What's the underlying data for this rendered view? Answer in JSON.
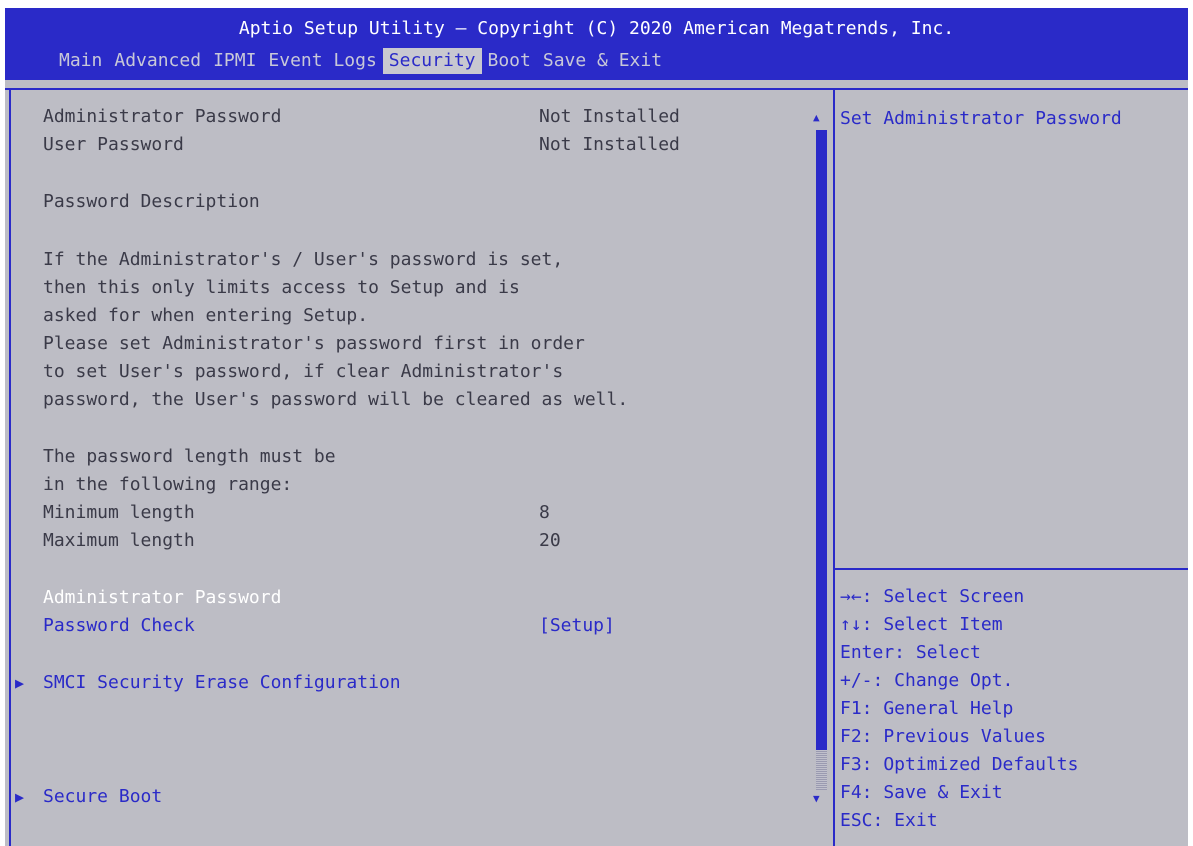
{
  "header": {
    "title": "Aptio Setup Utility – Copyright (C) 2020 American Megatrends, Inc.",
    "tabs": [
      "Main",
      "Advanced",
      "IPMI",
      "Event Logs",
      "Security",
      "Boot",
      "Save & Exit"
    ],
    "active_tab": "Security"
  },
  "main": {
    "admin_password_label": "Administrator Password",
    "admin_password_value": "Not Installed",
    "user_password_label": "User Password",
    "user_password_value": "Not Installed",
    "password_description_heading": "Password Description",
    "description_lines": [
      "If the Administrator's / User's password is set,",
      "then this only limits access to Setup and is",
      "asked for when entering Setup.",
      "Please set Administrator's password first in order",
      "to set User's password, if clear Administrator's",
      "password, the User's password will be cleared as well."
    ],
    "length_lines": [
      "The password length must be",
      "in the following range:"
    ],
    "min_length_label": "Minimum length",
    "min_length_value": "8",
    "max_length_label": "Maximum length",
    "max_length_value": "20",
    "admin_password_item": "Administrator Password",
    "password_check_label": "Password Check",
    "password_check_value": "[Setup]",
    "smci_erase_label": "SMCI Security Erase Configuration",
    "secure_boot_label": "Secure Boot"
  },
  "help": {
    "text": "Set Administrator Password"
  },
  "keys": [
    "→←: Select Screen",
    "↑↓: Select Item",
    "Enter: Select",
    "+/-: Change Opt.",
    "F1: General Help",
    "F2: Previous Values",
    "F3: Optimized Defaults",
    "F4: Save & Exit",
    "ESC: Exit"
  ],
  "colors": {
    "bios_blue": "#2a2ac8",
    "panel_gray": "#bdbdc5",
    "text_dark": "#3a3a48",
    "selected_white": "#ffffff"
  }
}
